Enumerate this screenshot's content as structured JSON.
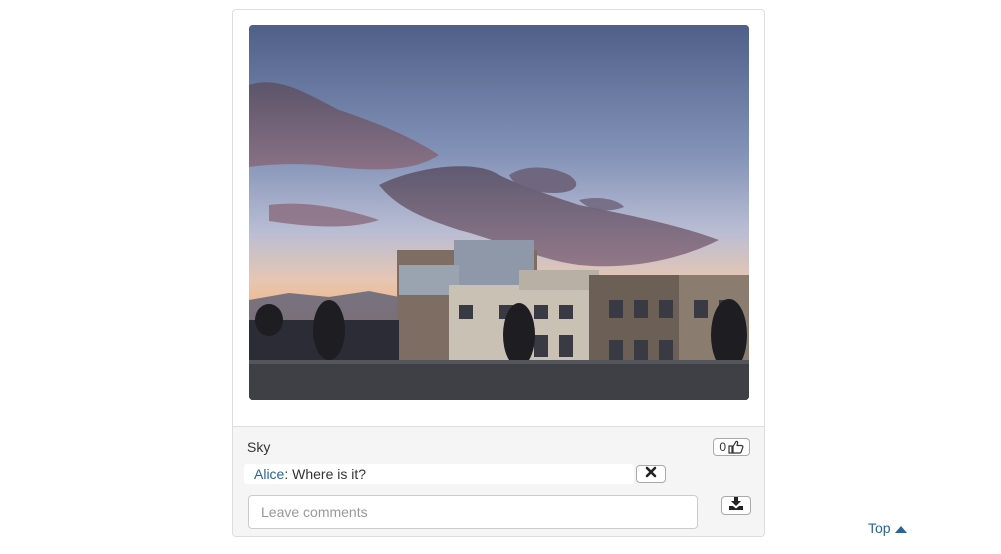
{
  "post": {
    "caption": "Sky",
    "like_count": "0",
    "photo_icon": "sunset-building-photo"
  },
  "comments": [
    {
      "author": "Alice",
      "separator": ": ",
      "text": "Where is it?"
    }
  ],
  "comment_form": {
    "placeholder": "Leave comments",
    "value": ""
  },
  "nav": {
    "top_label": "Top"
  },
  "icons": {
    "like": "thumbs-up-icon",
    "delete": "close-icon",
    "download": "download-icon",
    "top": "triangle-up-icon"
  },
  "colors": {
    "link": "#2a6496",
    "footer_bg": "#f5f5f5",
    "border": "#dddddd"
  }
}
